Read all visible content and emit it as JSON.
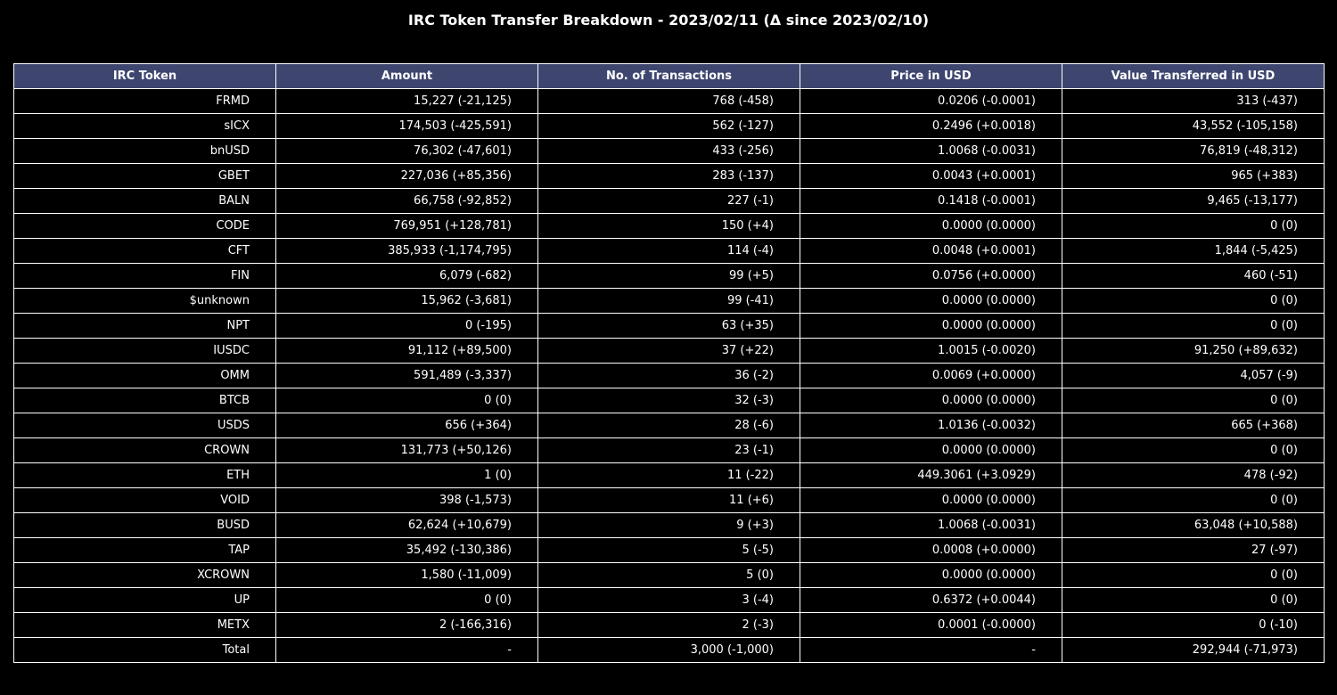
{
  "title": "IRC Token Transfer Breakdown - 2023/02/11 (Δ since 2023/02/10)",
  "colors": {
    "background": "#000000",
    "header_background": "#3e4670",
    "text": "#ffffff",
    "grid": "#ffffff"
  },
  "chart_data": {
    "type": "table",
    "title": "IRC Token Transfer Breakdown - 2023/02/11 (Δ since 2023/02/10)",
    "columns": [
      "IRC Token",
      "Amount",
      "No. of Transactions",
      "Price in USD",
      "Value Transferred in USD"
    ],
    "rows": [
      [
        "FRMD",
        "15,227 (-21,125)",
        "768 (-458)",
        "0.0206 (-0.0001)",
        "313 (-437)"
      ],
      [
        "sICX",
        "174,503 (-425,591)",
        "562 (-127)",
        "0.2496 (+0.0018)",
        "43,552 (-105,158)"
      ],
      [
        "bnUSD",
        "76,302 (-47,601)",
        "433 (-256)",
        "1.0068 (-0.0031)",
        "76,819 (-48,312)"
      ],
      [
        "GBET",
        "227,036 (+85,356)",
        "283 (-137)",
        "0.0043 (+0.0001)",
        "965 (+383)"
      ],
      [
        "BALN",
        "66,758 (-92,852)",
        "227 (-1)",
        "0.1418 (-0.0001)",
        "9,465 (-13,177)"
      ],
      [
        "CODE",
        "769,951 (+128,781)",
        "150 (+4)",
        "0.0000 (0.0000)",
        "0 (0)"
      ],
      [
        "CFT",
        "385,933 (-1,174,795)",
        "114 (-4)",
        "0.0048 (+0.0001)",
        "1,844 (-5,425)"
      ],
      [
        "FIN",
        "6,079 (-682)",
        "99 (+5)",
        "0.0756 (+0.0000)",
        "460 (-51)"
      ],
      [
        "$unknown",
        "15,962 (-3,681)",
        "99 (-41)",
        "0.0000 (0.0000)",
        "0 (0)"
      ],
      [
        "NPT",
        "0 (-195)",
        "63 (+35)",
        "0.0000 (0.0000)",
        "0 (0)"
      ],
      [
        "IUSDC",
        "91,112 (+89,500)",
        "37 (+22)",
        "1.0015 (-0.0020)",
        "91,250 (+89,632)"
      ],
      [
        "OMM",
        "591,489 (-3,337)",
        "36 (-2)",
        "0.0069 (+0.0000)",
        "4,057 (-9)"
      ],
      [
        "BTCB",
        "0 (0)",
        "32 (-3)",
        "0.0000 (0.0000)",
        "0 (0)"
      ],
      [
        "USDS",
        "656 (+364)",
        "28 (-6)",
        "1.0136 (-0.0032)",
        "665 (+368)"
      ],
      [
        "CROWN",
        "131,773 (+50,126)",
        "23 (-1)",
        "0.0000 (0.0000)",
        "0 (0)"
      ],
      [
        "ETH",
        "1 (0)",
        "11 (-22)",
        "449.3061 (+3.0929)",
        "478 (-92)"
      ],
      [
        "VOID",
        "398 (-1,573)",
        "11 (+6)",
        "0.0000 (0.0000)",
        "0 (0)"
      ],
      [
        "BUSD",
        "62,624 (+10,679)",
        "9 (+3)",
        "1.0068 (-0.0031)",
        "63,048 (+10,588)"
      ],
      [
        "TAP",
        "35,492 (-130,386)",
        "5 (-5)",
        "0.0008 (+0.0000)",
        "27 (-97)"
      ],
      [
        "XCROWN",
        "1,580 (-11,009)",
        "5 (0)",
        "0.0000 (0.0000)",
        "0 (0)"
      ],
      [
        "UP",
        "0 (0)",
        "3 (-4)",
        "0.6372 (+0.0044)",
        "0 (0)"
      ],
      [
        "METX",
        "2 (-166,316)",
        "2 (-3)",
        "0.0001 (-0.0000)",
        "0 (-10)"
      ],
      [
        "Total",
        "-",
        "3,000 (-1,000)",
        "-",
        "292,944 (-71,973)"
      ]
    ]
  }
}
